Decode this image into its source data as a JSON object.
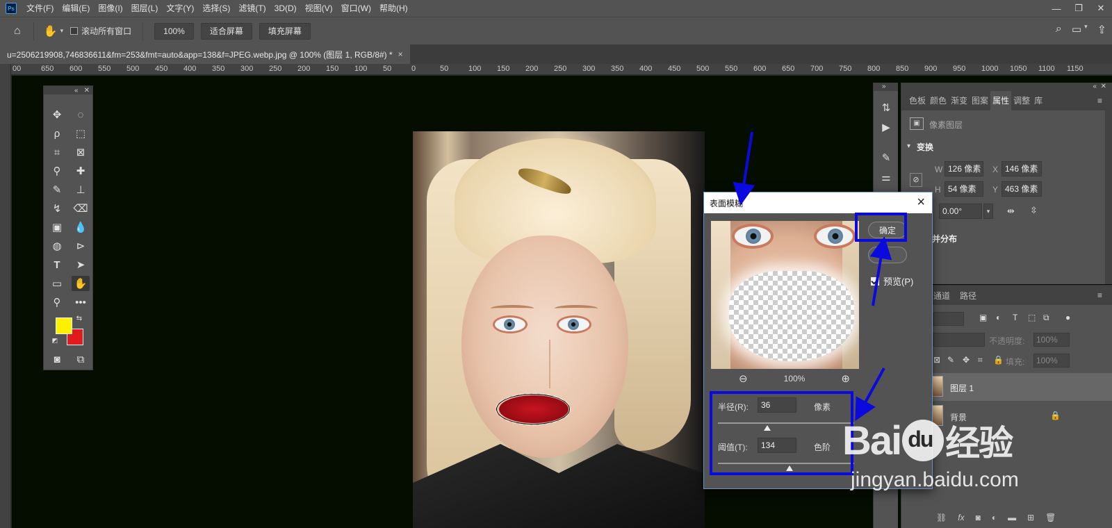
{
  "app": {
    "logo": "Ps",
    "menu": [
      "文件(F)",
      "编辑(E)",
      "图像(I)",
      "图层(L)",
      "文字(Y)",
      "选择(S)",
      "滤镜(T)",
      "3D(D)",
      "视图(V)",
      "窗口(W)",
      "帮助(H)"
    ]
  },
  "options_bar": {
    "scroll_all_label": "滚动所有窗口",
    "zoom_value": "100%",
    "fit_screen_label": "适合屏幕",
    "fill_screen_label": "填充屏幕"
  },
  "document_tab": {
    "title": "u=2506219908,746836611&fm=253&fmt=auto&app=138&f=JPEG.webp.jpg @ 100% (图层 1, RGB/8#) *",
    "close": "×"
  },
  "ruler_labels": [
    "00",
    "650",
    "600",
    "550",
    "500",
    "450",
    "400",
    "350",
    "300",
    "250",
    "200",
    "150",
    "100",
    "50",
    "0",
    "50",
    "100",
    "150",
    "200",
    "250",
    "300",
    "350",
    "400",
    "450",
    "500",
    "550",
    "600",
    "650",
    "700",
    "750",
    "800",
    "850",
    "900",
    "950",
    "1000",
    "1050",
    "1100",
    "1150"
  ],
  "colors": {
    "foreground": "#fdf000",
    "background": "#e01b1b",
    "annotation": "#0a0adf"
  },
  "properties_panel": {
    "tabs": [
      "色板",
      "颜色",
      "渐变",
      "图案",
      "属性",
      "调整",
      "库"
    ],
    "active_tab": "属性",
    "layer_kind": "像素图层",
    "transform_heading": "变换",
    "w_label": "W",
    "w_value": "126 像素",
    "x_label": "X",
    "x_value": "146 像素",
    "h_label": "H",
    "h_value": "54 像素",
    "y_label": "Y",
    "y_value": "463 像素",
    "angle_value": "0.00°",
    "align_heading": "并分布"
  },
  "layers_panel": {
    "tabs": [
      "通道",
      "路径"
    ],
    "opacity_label": "不透明度:",
    "opacity_value": "100%",
    "fill_label": "填充:",
    "fill_value": "100%",
    "layers": [
      {
        "name": "图层 1",
        "selected": true
      },
      {
        "name": "背景",
        "locked": true
      }
    ]
  },
  "dialog": {
    "title": "表面模糊",
    "ok_label": "确定",
    "cancel_label": "...",
    "preview_label": "预览(P)",
    "preview_checked": true,
    "zoom_value": "100%",
    "radius_label": "半径(R):",
    "radius_value": "36",
    "radius_unit": "像素",
    "threshold_label": "阈值(T):",
    "threshold_value": "134",
    "threshold_unit": "色阶"
  },
  "watermark": {
    "brand_a": "Bai",
    "brand_paw": "du",
    "brand_b": "经验",
    "url": "jingyan.baidu.com"
  }
}
